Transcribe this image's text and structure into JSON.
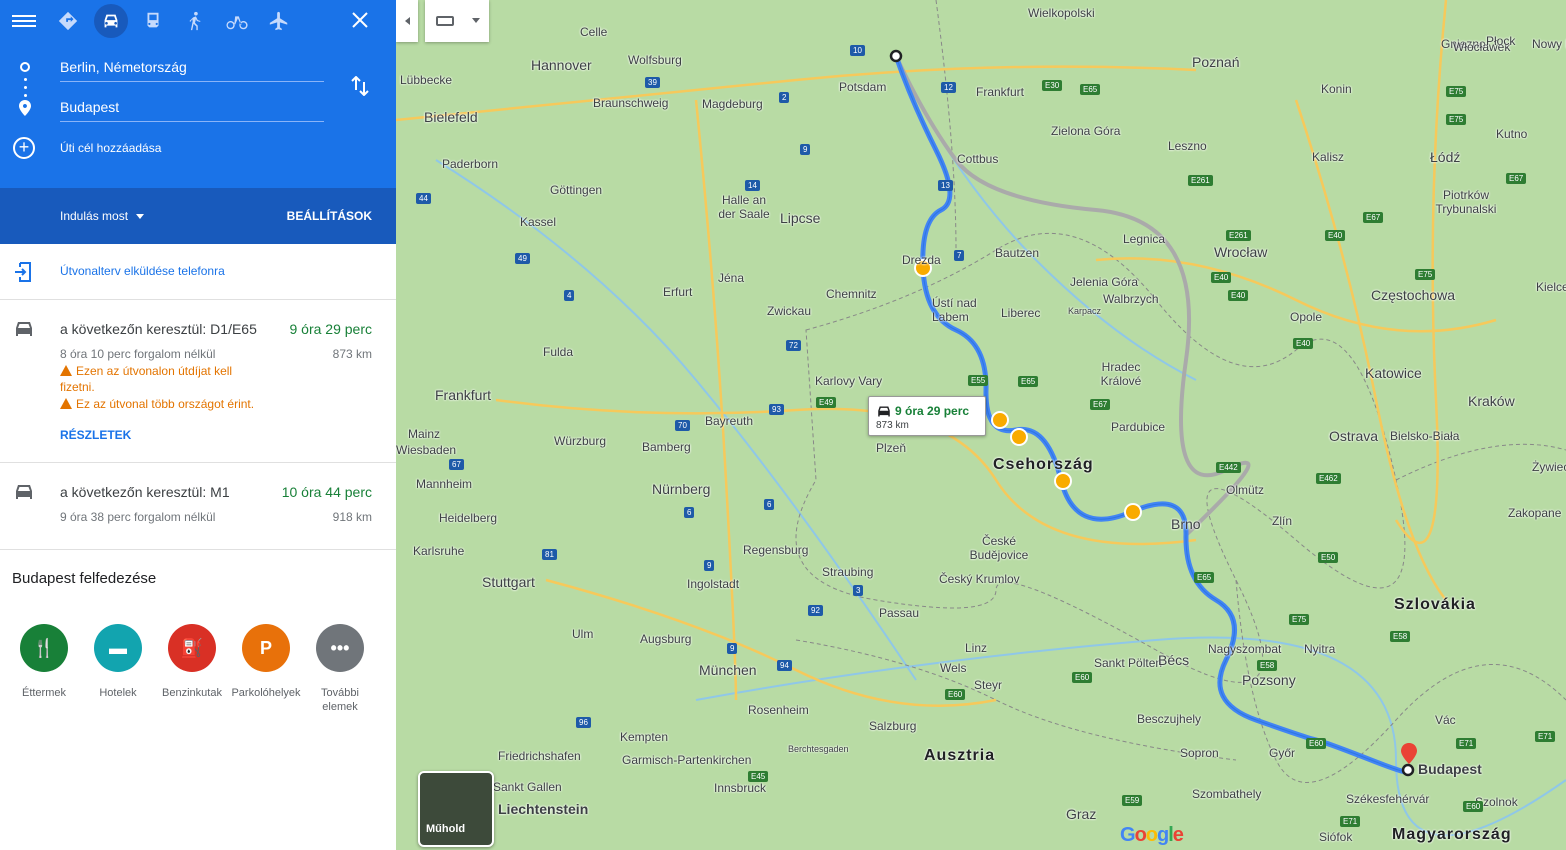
{
  "panel": {
    "modes": [
      {
        "name": "best-mode",
        "icon": "directions-icon",
        "selected": false
      },
      {
        "name": "car-mode",
        "icon": "car-icon",
        "selected": true
      },
      {
        "name": "transit-mode",
        "icon": "train-icon",
        "selected": false
      },
      {
        "name": "walk-mode",
        "icon": "walk-icon",
        "selected": false
      },
      {
        "name": "bike-mode",
        "icon": "bike-icon",
        "selected": false
      },
      {
        "name": "flight-mode",
        "icon": "plane-icon",
        "selected": false
      }
    ],
    "origin": "Berlin, Németország",
    "destination": "Budapest",
    "add_destination": "Úti cél hozzáadása",
    "depart": "Indulás most",
    "options": "BEÁLLÍTÁSOK",
    "send_to_phone": "Útvonalterv elküldése telefonra",
    "routes": [
      {
        "via": "a következőn keresztül: D1/E65",
        "time": "9 óra 29 perc",
        "no_traffic": "8 óra 10 perc forgalom nélkül",
        "distance": "873 km",
        "warning1": "Ezen az útvonalon útdíjat kell fizetni.",
        "warning2": "Ez az útvonal több országot érint.",
        "details": "RÉSZLETEK"
      },
      {
        "via": "a következőn keresztül: M1",
        "time": "10 óra 44 perc",
        "no_traffic": "9 óra 38 perc forgalom nélkül",
        "distance": "918 km"
      }
    ],
    "explore_title": "Budapest felfedezése",
    "categories": [
      {
        "label": "Éttermek",
        "icon": "restaurant-icon",
        "color": "#188038"
      },
      {
        "label": "Hotelek",
        "icon": "hotel-icon",
        "color": "#12a4af"
      },
      {
        "label": "Benzinkutak",
        "icon": "gas-station-icon",
        "color": "#d93025"
      },
      {
        "label": "Parkolóhelyek",
        "icon": "parking-icon",
        "color": "#e8710a"
      },
      {
        "label": "További elemek",
        "icon": "more-icon",
        "color": "#70757a"
      }
    ]
  },
  "map": {
    "callout_time": "9 óra 29 perc",
    "callout_distance": "873 km",
    "satellite_label": "Műhold",
    "google_logo": "Google",
    "route_color": "#4285f4",
    "alt_route_color": "#aaaaaa",
    "places": [
      "Celle",
      "Wielkopolski",
      "Gniezno",
      "Włocławek",
      "Płock",
      "Nowy D",
      "Hannover",
      "Wolfsburg",
      "Poznań",
      "Konin",
      "Lübbecke",
      "Potsdam",
      "Frankfurt",
      "Bielefeld",
      "Braunschweig",
      "Magdeburg",
      "Zielona Góra",
      "Kutno",
      "Łódź",
      "Cottbus",
      "Leszno",
      "Kalisz",
      "Paderborn",
      "Göttingen",
      "Piotrków Trybunalski",
      "Halle an der Saale",
      "Lipcse",
      "Legnica",
      "Kassel",
      "Bautzen",
      "Wrocław",
      "Drezda",
      "Jelenia Góra",
      "Jéna",
      "Erfurt",
      "Chemnitz",
      "Walbrzych",
      "Ústí nad Labem",
      "Liberec",
      "Karpacz",
      "Częstochowa",
      "Kielce",
      "Zwickau",
      "Opole",
      "Fulda",
      "Katowice",
      "Karlovy Vary",
      "Hradec Králové",
      "Kraków",
      "Frankfurt",
      "Pardubice",
      "Ostrava",
      "Bielsko-Biała",
      "Mainz",
      "Bayreuth",
      "Wiesbaden",
      "Plzeň",
      "Csehország",
      "Olmütz",
      "Żywiec",
      "Würzburg",
      "Bamberg",
      "Mannheim",
      "Nürnberg",
      "Zakopane",
      "Heidelberg",
      "Zlín",
      "Brno",
      "Karlsruhe",
      "Regensburg",
      "České Budějovice",
      "Stuttgart",
      "Ingolstadt",
      "Straubing",
      "Český Krumlov",
      "Szlovákia",
      "Ulm",
      "Passau",
      "Augsburg",
      "Linz",
      "Nagyszombat",
      "Nyitra",
      "München",
      "Wels",
      "Sankt Pölten",
      "Bécs",
      "Pozsony",
      "Steyr",
      "Rosenheim",
      "Salzburg",
      "Besczujhely",
      "Vác",
      "Kempten",
      "Friedrichshafen",
      "Garmisch-Partenkirchen",
      "Berchtesgaden",
      "Sopron",
      "Győr",
      "Budapest",
      "Ausztria",
      "Sankt Gallen",
      "Innsbruck",
      "Szombathely",
      "Székesfehérvár",
      "Szolnok",
      "Liechtenstein",
      "Graz",
      "Siófok",
      "Magyarország"
    ],
    "roads": [
      "10",
      "E30",
      "E65",
      "E75",
      "12",
      "39",
      "2",
      "E30",
      "E75",
      "E67",
      "9",
      "E261",
      "13",
      "E67",
      "44",
      "14",
      "E40",
      "E261",
      "7",
      "E40",
      "49",
      "E75",
      "4",
      "E40",
      "E40",
      "72",
      "E55",
      "E65",
      "E67",
      "93",
      "70",
      "67",
      "E49",
      "E462",
      "E442",
      "E50",
      "6",
      "6",
      "E65",
      "81",
      "9",
      "3",
      "E58",
      "E75",
      "92",
      "9",
      "E58",
      "94",
      "96",
      "E60",
      "E60",
      "E60",
      "E71",
      "E60",
      "E71",
      "E45",
      "E59",
      "E71",
      "E60"
    ]
  }
}
